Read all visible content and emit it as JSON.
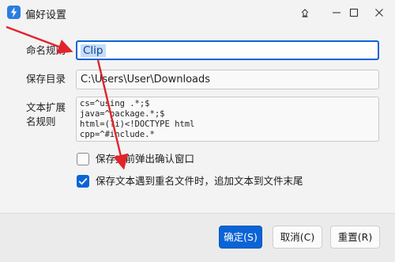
{
  "window": {
    "title": "偏好设置",
    "accent_color": "#0a64d6",
    "annotation_color": "#e0242a",
    "title_buttons": [
      "pin-icon",
      "minimize-icon",
      "maximize-icon",
      "close-icon"
    ]
  },
  "form": {
    "naming_label": "命名规则",
    "naming_value": "Clip",
    "dir_label": "保存目录",
    "dir_value": "C:\\Users\\User\\Downloads",
    "ext_label": "文本扩展名规则",
    "ext_lines": [
      "cs=^using .*;$",
      "java=^package.*;$",
      "html=(?i)<!DOCTYPE html",
      "cpp=^#include.*"
    ],
    "confirm_label": "保存文前弹出确认窗口",
    "confirm_checked": false,
    "append_label": "保存文本遇到重名文件时，追加文本到文件末尾",
    "append_checked": true
  },
  "buttons": {
    "ok": "确定(S)",
    "cancel": "取消(C)",
    "reset": "重置(R)"
  }
}
